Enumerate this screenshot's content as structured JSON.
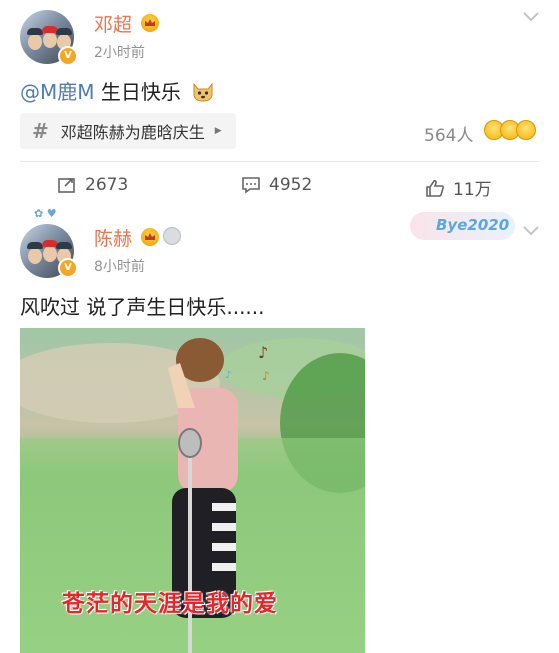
{
  "posts": [
    {
      "author": "邓超",
      "time": "2小时前",
      "text_mention": "@M鹿M",
      "text_body": " 生日快乐",
      "topic": {
        "label": "邓超陈赫为鹿晗庆生",
        "count": "564人"
      },
      "actions": {
        "repost": "2673",
        "comment": "4952",
        "like": "11万"
      }
    },
    {
      "author": "陈赫",
      "time": "8小时前",
      "text_body": "风吹过 说了声生日快乐......",
      "card_label": "Bye2020",
      "image_subtitle": "苍茫的天涯是我的爱"
    }
  ],
  "colors": {
    "name": "#eb7350",
    "mention": "#507daf",
    "badge": "#f5a623",
    "subtitle": "#e8252b"
  }
}
